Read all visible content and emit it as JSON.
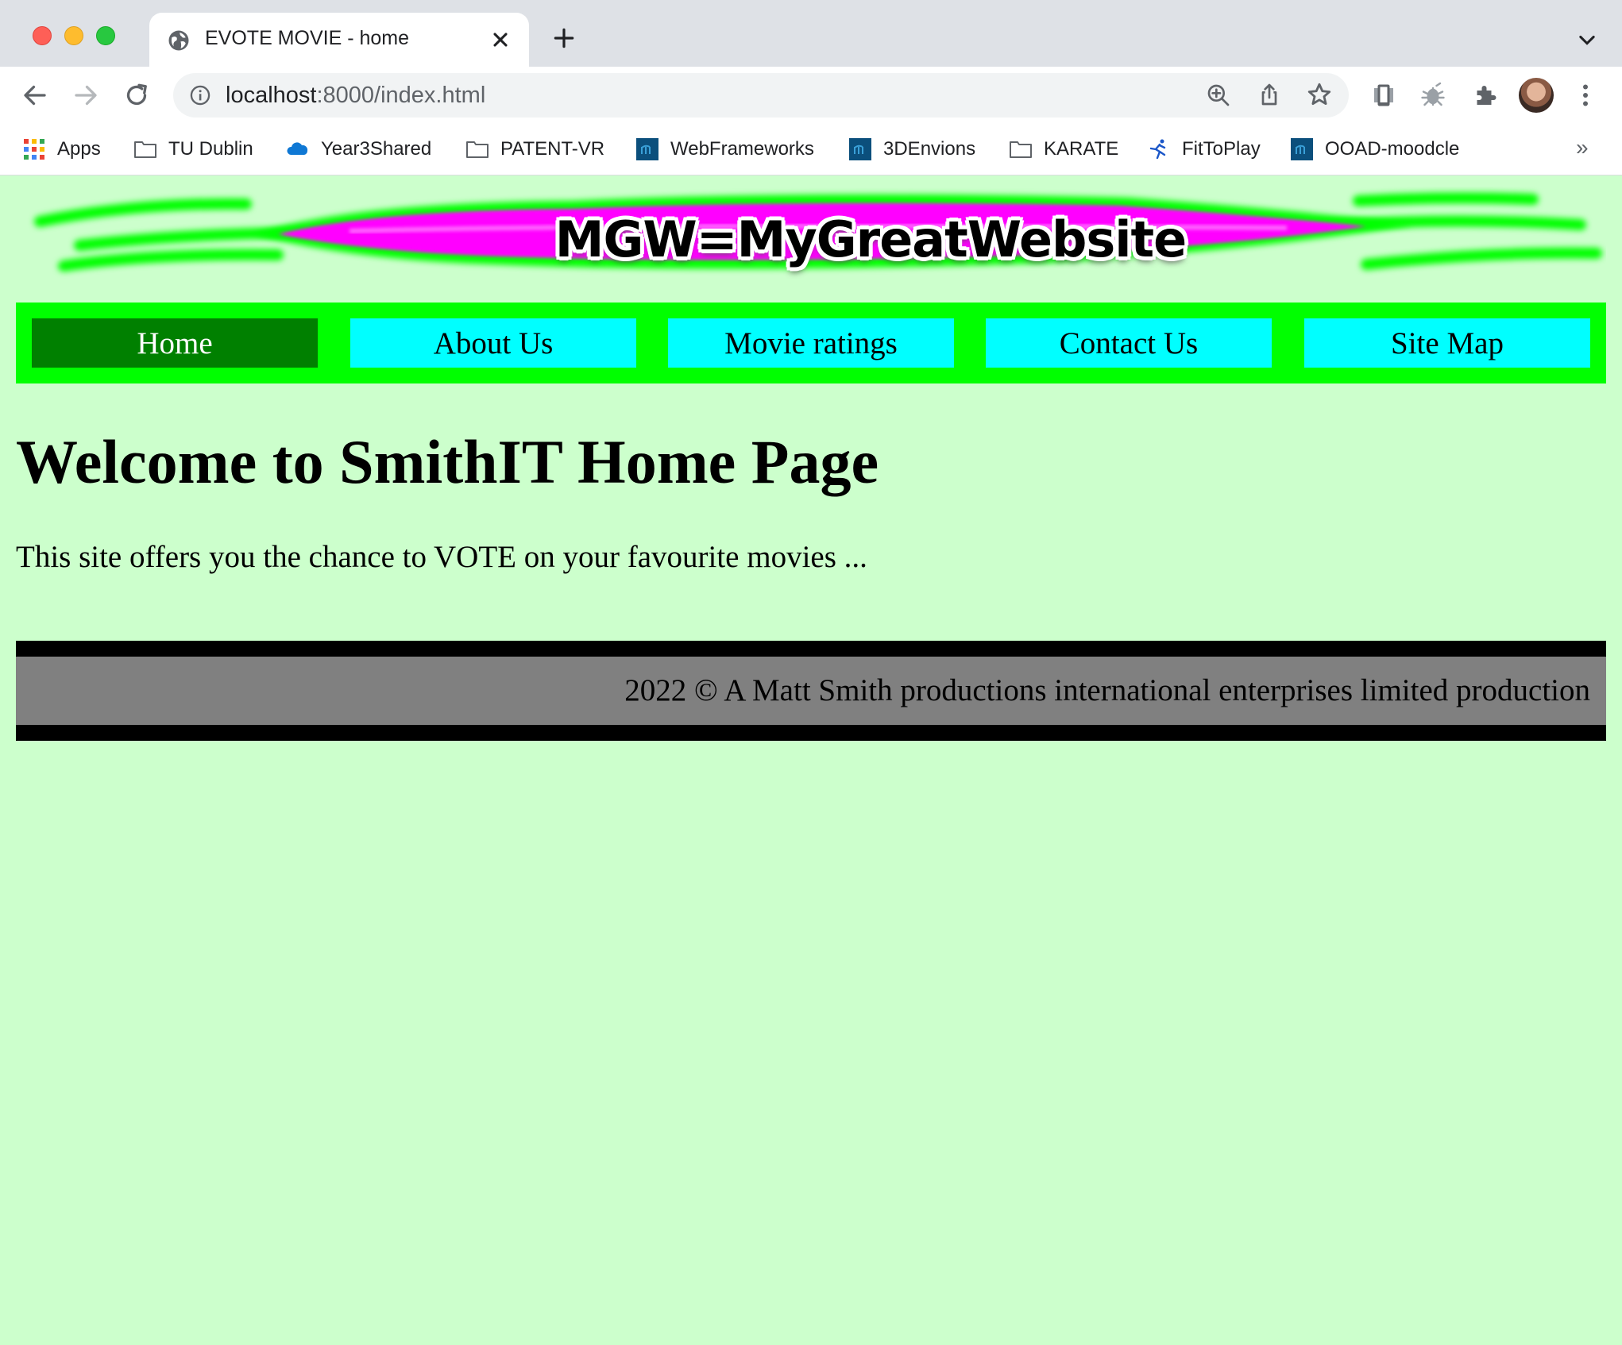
{
  "browser": {
    "tab": {
      "title": "EVOTE MOVIE - home"
    },
    "address": {
      "host": "localhost",
      "rest": ":8000/index.html"
    },
    "bookmarks": [
      {
        "label": "Apps",
        "icon": "apps-grid-icon"
      },
      {
        "label": "TU Dublin",
        "icon": "folder-icon"
      },
      {
        "label": "Year3Shared",
        "icon": "onedrive-cloud-icon"
      },
      {
        "label": "PATENT-VR",
        "icon": "folder-icon"
      },
      {
        "label": "WebFrameworks",
        "icon": "moodle-icon"
      },
      {
        "label": "3DEnvions",
        "icon": "moodle-icon"
      },
      {
        "label": "KARATE",
        "icon": "folder-icon"
      },
      {
        "label": "FitToPlay",
        "icon": "runner-icon"
      },
      {
        "label": "OOAD-moodcle",
        "icon": "moodle-icon"
      }
    ],
    "bookmarks_overflow": "»"
  },
  "site": {
    "banner_text": "MGW=MyGreatWebsite",
    "nav": [
      {
        "label": "Home",
        "active": true
      },
      {
        "label": "About Us",
        "active": false
      },
      {
        "label": "Movie ratings",
        "active": false
      },
      {
        "label": "Contact Us",
        "active": false
      },
      {
        "label": "Site Map",
        "active": false
      }
    ],
    "heading": "Welcome to SmithIT Home Page",
    "intro": "This site offers you the chance to VOTE on your favourite movies ...",
    "footer": "2022 © A Matt Smith productions international enterprises limited production"
  },
  "colors": {
    "page_background": "#ccffcc",
    "nav_background": "#00ff00",
    "nav_item": "#00ffff",
    "nav_active": "#008000",
    "footer_background": "#808080",
    "footer_border": "#000000",
    "banner_stripe": "#ff00ff",
    "banner_glow": "#00ff00"
  }
}
